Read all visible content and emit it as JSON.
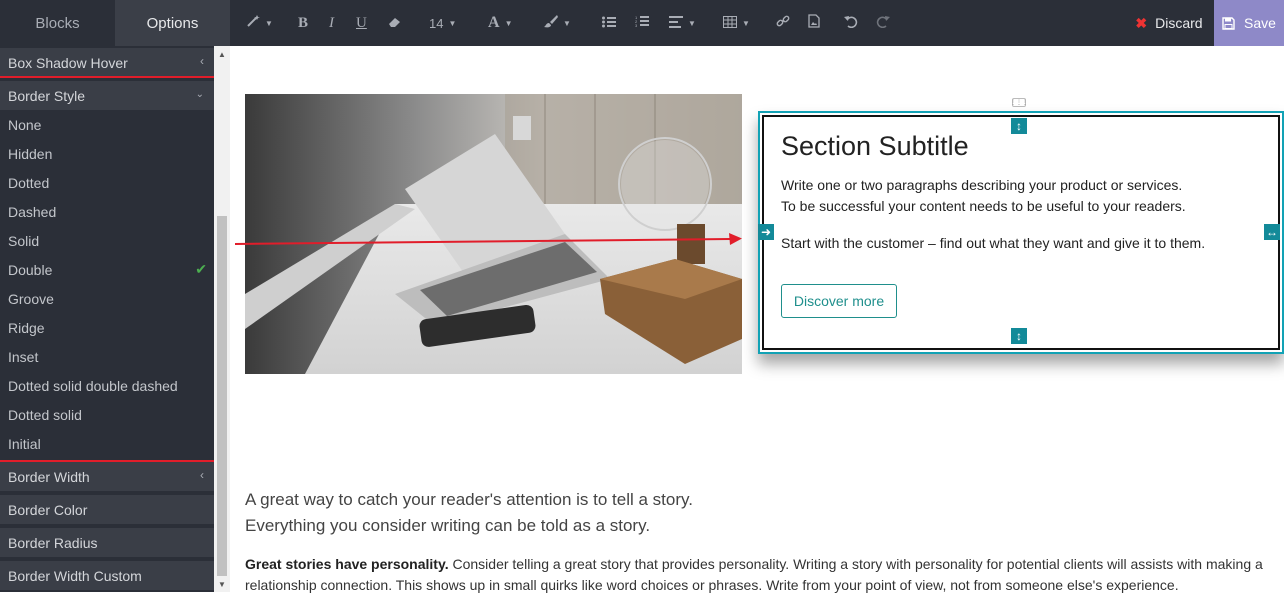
{
  "panel_tabs": {
    "blocks": "Blocks",
    "options": "Options"
  },
  "options": {
    "box_shadow_hover": "Box Shadow Hover",
    "border_style": {
      "label": "Border Style",
      "items": [
        "None",
        "Hidden",
        "Dotted",
        "Dashed",
        "Solid",
        "Double",
        "Groove",
        "Ridge",
        "Inset",
        "Dotted solid double dashed",
        "Dotted solid",
        "Initial"
      ],
      "selected": "Double"
    },
    "border_width": "Border Width",
    "border_color": "Border Color",
    "border_radius": "Border Radius",
    "border_width_custom": "Border Width Custom"
  },
  "toolbar": {
    "font_size": "14",
    "discard_label": "Discard",
    "save_label": "Save",
    "icons": [
      "magic-wand-icon",
      "bold-icon",
      "italic-icon",
      "underline-icon",
      "eraser-icon",
      "font-size-dropdown",
      "font-color-icon",
      "brush-icon",
      "bullet-list-icon",
      "numbered-list-icon",
      "align-icon",
      "table-icon",
      "link-icon",
      "image-icon",
      "undo-icon",
      "redo-icon"
    ]
  },
  "section": {
    "title": "Section Subtitle",
    "line1": "Write one or two paragraphs describing your product or services.",
    "line2": "To be successful your content needs to be useful to your readers.",
    "line3": "Start with the customer – find out what they want and give it to them.",
    "button": "Discover more"
  },
  "story": {
    "lead1": "A great way to catch your reader's attention is to tell a story.",
    "lead2": "Everything you consider writing can be told as a story.",
    "body_bold": "Great stories have personality.",
    "body_text": " Consider telling a great story that provides personality. Writing a story with personality for potential clients will assists with making a relationship connection. This shows up in small quirks like word choices or phrases. Write from your point of view, not from someone else's experience."
  },
  "colors": {
    "panel_bg": "#2b2f38",
    "accent_teal": "#12a2b5",
    "save_purple": "#8e89c8",
    "highlight_red": "#e11d2a",
    "check_green": "#4caf50"
  }
}
